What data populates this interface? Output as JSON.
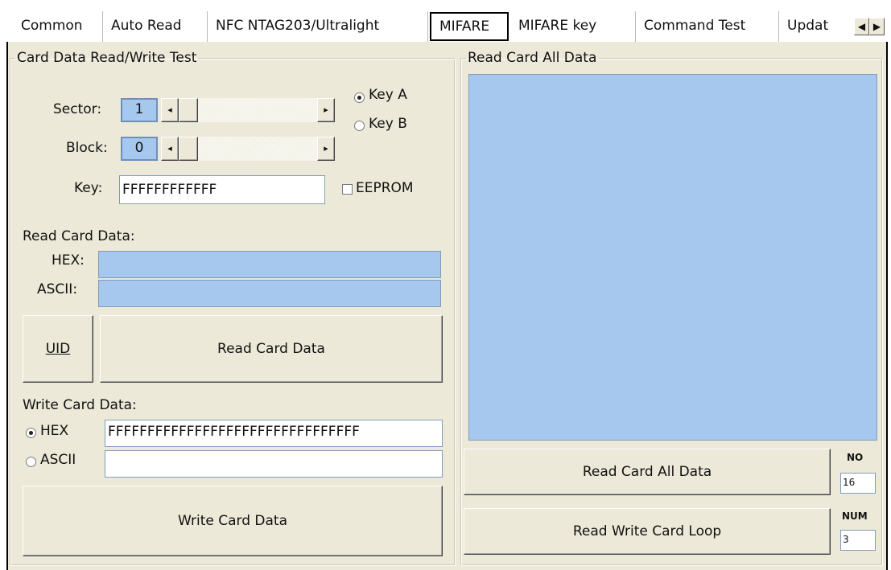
{
  "tabs": [
    "Common",
    "Auto Read",
    "NFC NTAG203/Ultralight",
    "MIFARE",
    "MIFARE key",
    "Command Test",
    "Updat"
  ],
  "active_tab": "MIFARE",
  "left_group": {
    "title": "Card Data Read/Write Test",
    "sector_label": "Sector:",
    "sector_value": "1",
    "block_label": "Block:",
    "block_value": "0",
    "key_a_label": "Key A",
    "key_b_label": "Key B",
    "key_label": "Key:",
    "key_value": "FFFFFFFFFFFF",
    "eeprom_label": "EEPROM",
    "read_section_label": "Read Card Data:",
    "hex_label": "HEX:",
    "ascii_label": "ASCII:",
    "hex_value": "",
    "ascii_value": "",
    "uid_button_label": "UID",
    "read_button_label": "Read Card Data",
    "write_section_label": "Write Card Data:",
    "write_hex_label": "HEX",
    "write_ascii_label": "ASCII",
    "write_hex_value": "FFFFFFFFFFFFFFFFFFFFFFFFFFFFFFFF",
    "write_ascii_value": "",
    "write_button_label": "Write Card Data"
  },
  "right_group": {
    "title": "Read Card All Data",
    "read_all_button_label": "Read Card All Data",
    "loop_button_label": "Read Write Card Loop",
    "no_label": "NO",
    "no_value": "16",
    "num_label": "NUM",
    "num_value": "3"
  },
  "colors": {
    "panel_bg": "#ece9d8",
    "field_highlight": "#a6c8ef",
    "field_border": "#7f9db9"
  },
  "icons": {
    "scroll_left": "◀",
    "scroll_right": "▶",
    "small_left": "◂",
    "small_right": "▸"
  }
}
